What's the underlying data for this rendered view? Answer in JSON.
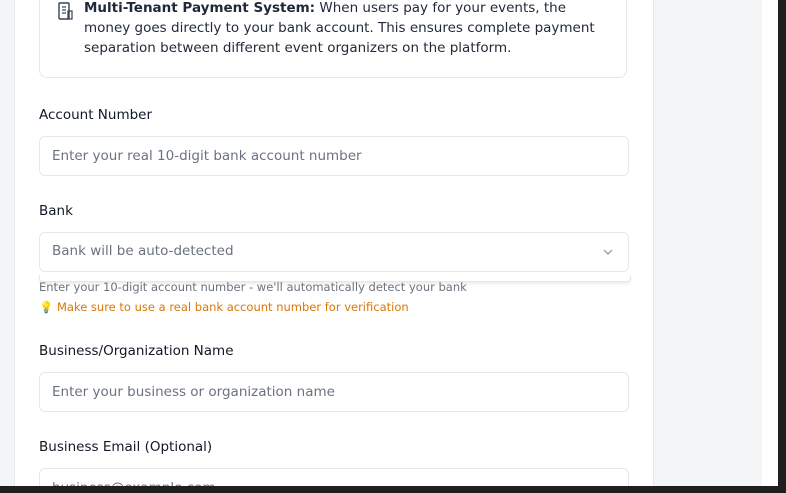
{
  "info": {
    "title": "Multi-Tenant Payment System:",
    "body": "When users pay for your events, the money goes directly to your bank account. This ensures complete payment separation between different event organizers on the platform.",
    "icon": "bank-building-icon"
  },
  "account": {
    "label": "Account Number",
    "placeholder": "Enter your real 10-digit bank account number"
  },
  "bank": {
    "label": "Bank",
    "value": "Bank will be auto-detected",
    "icon": "chevron-down-icon",
    "help": "Enter your 10-digit account number - we'll automatically detect your bank",
    "tip": "💡 Make sure to use a real bank account number for verification"
  },
  "business": {
    "label": "Business/Organization Name",
    "placeholder": "Enter your business or organization name"
  },
  "email": {
    "label": "Business Email (Optional)",
    "placeholder": "business@example.com"
  },
  "colors": {
    "accent_tip": "#d97706",
    "border": "#e5e7eb",
    "background": "#f4f5f7"
  }
}
